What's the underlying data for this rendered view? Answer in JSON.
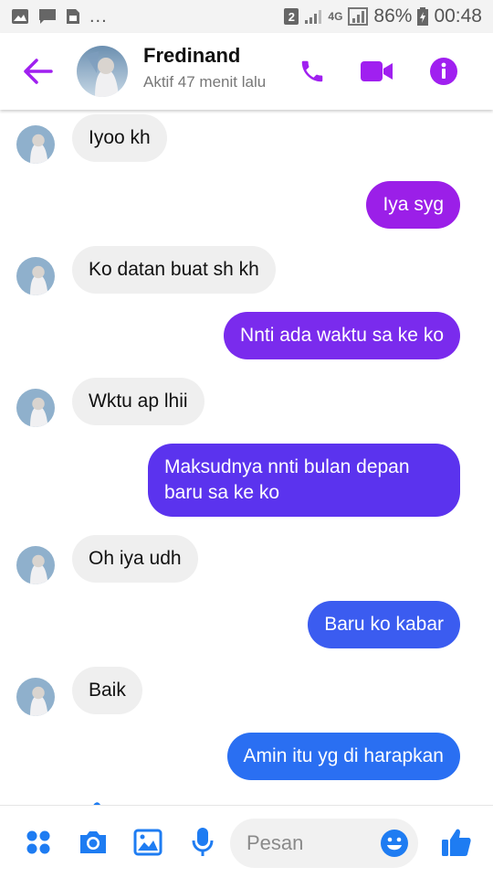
{
  "status_bar": {
    "sim_badge": "2",
    "network": "4G",
    "battery": "86%",
    "time": "00:48",
    "overflow": "..."
  },
  "header": {
    "name": "Fredinand",
    "status": "Aktif 47 menit lalu",
    "accent": "#a020f0"
  },
  "messages": [
    {
      "from": "them",
      "text": "Iyoo kh"
    },
    {
      "from": "me",
      "text": "Iya syg",
      "color": "#9b1fe8"
    },
    {
      "from": "them",
      "text": "Ko datan buat sh kh"
    },
    {
      "from": "me",
      "text": "Nnti ada waktu sa ke ko",
      "color": "#7a2bed"
    },
    {
      "from": "them",
      "text": "Wktu ap lhii"
    },
    {
      "from": "me",
      "text": "Maksudnya nnti bulan depan baru sa ke ko",
      "color": "#5b33ee"
    },
    {
      "from": "them",
      "text": "Oh iya udh"
    },
    {
      "from": "me",
      "text": "Baru ko kabar",
      "color": "#3b5cf0"
    },
    {
      "from": "them",
      "text": "Baik"
    },
    {
      "from": "me",
      "text": "Amin itu yg di harapkan",
      "color": "#2a6ff2"
    }
  ],
  "composer": {
    "placeholder": "Pesan",
    "accent": "#1e7cf2"
  },
  "icons": {
    "header": [
      "back-arrow-icon",
      "phone-icon",
      "video-camera-icon",
      "info-icon"
    ],
    "composer": [
      "apps-icon",
      "camera-icon",
      "gallery-icon",
      "microphone-icon",
      "emoji-icon",
      "thumbs-up-icon"
    ]
  }
}
